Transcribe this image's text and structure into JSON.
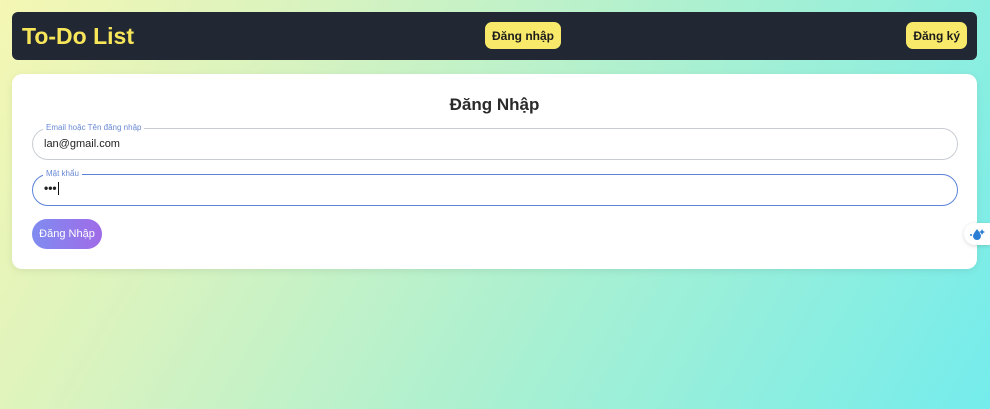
{
  "navbar": {
    "brand": "To-Do List",
    "login_label": "Đăng nhập",
    "register_label": "Đăng ký"
  },
  "form": {
    "title": "Đăng Nhập",
    "email": {
      "label": "Email hoặc Tên đăng nhập",
      "value": "lan@gmail.com"
    },
    "password": {
      "label": "Mật khẩu",
      "value": "•••"
    },
    "submit_label": "Đăng Nhập"
  },
  "colors": {
    "navbar_bg": "#212733",
    "brand": "#f7e65a",
    "nav_button": "#f9e96a",
    "focus_border": "#5b83d8",
    "submit_gradient_start": "#7f8cf0",
    "submit_gradient_end": "#a06be8"
  },
  "icons": {
    "extension_widget": "water-drop-icon"
  }
}
